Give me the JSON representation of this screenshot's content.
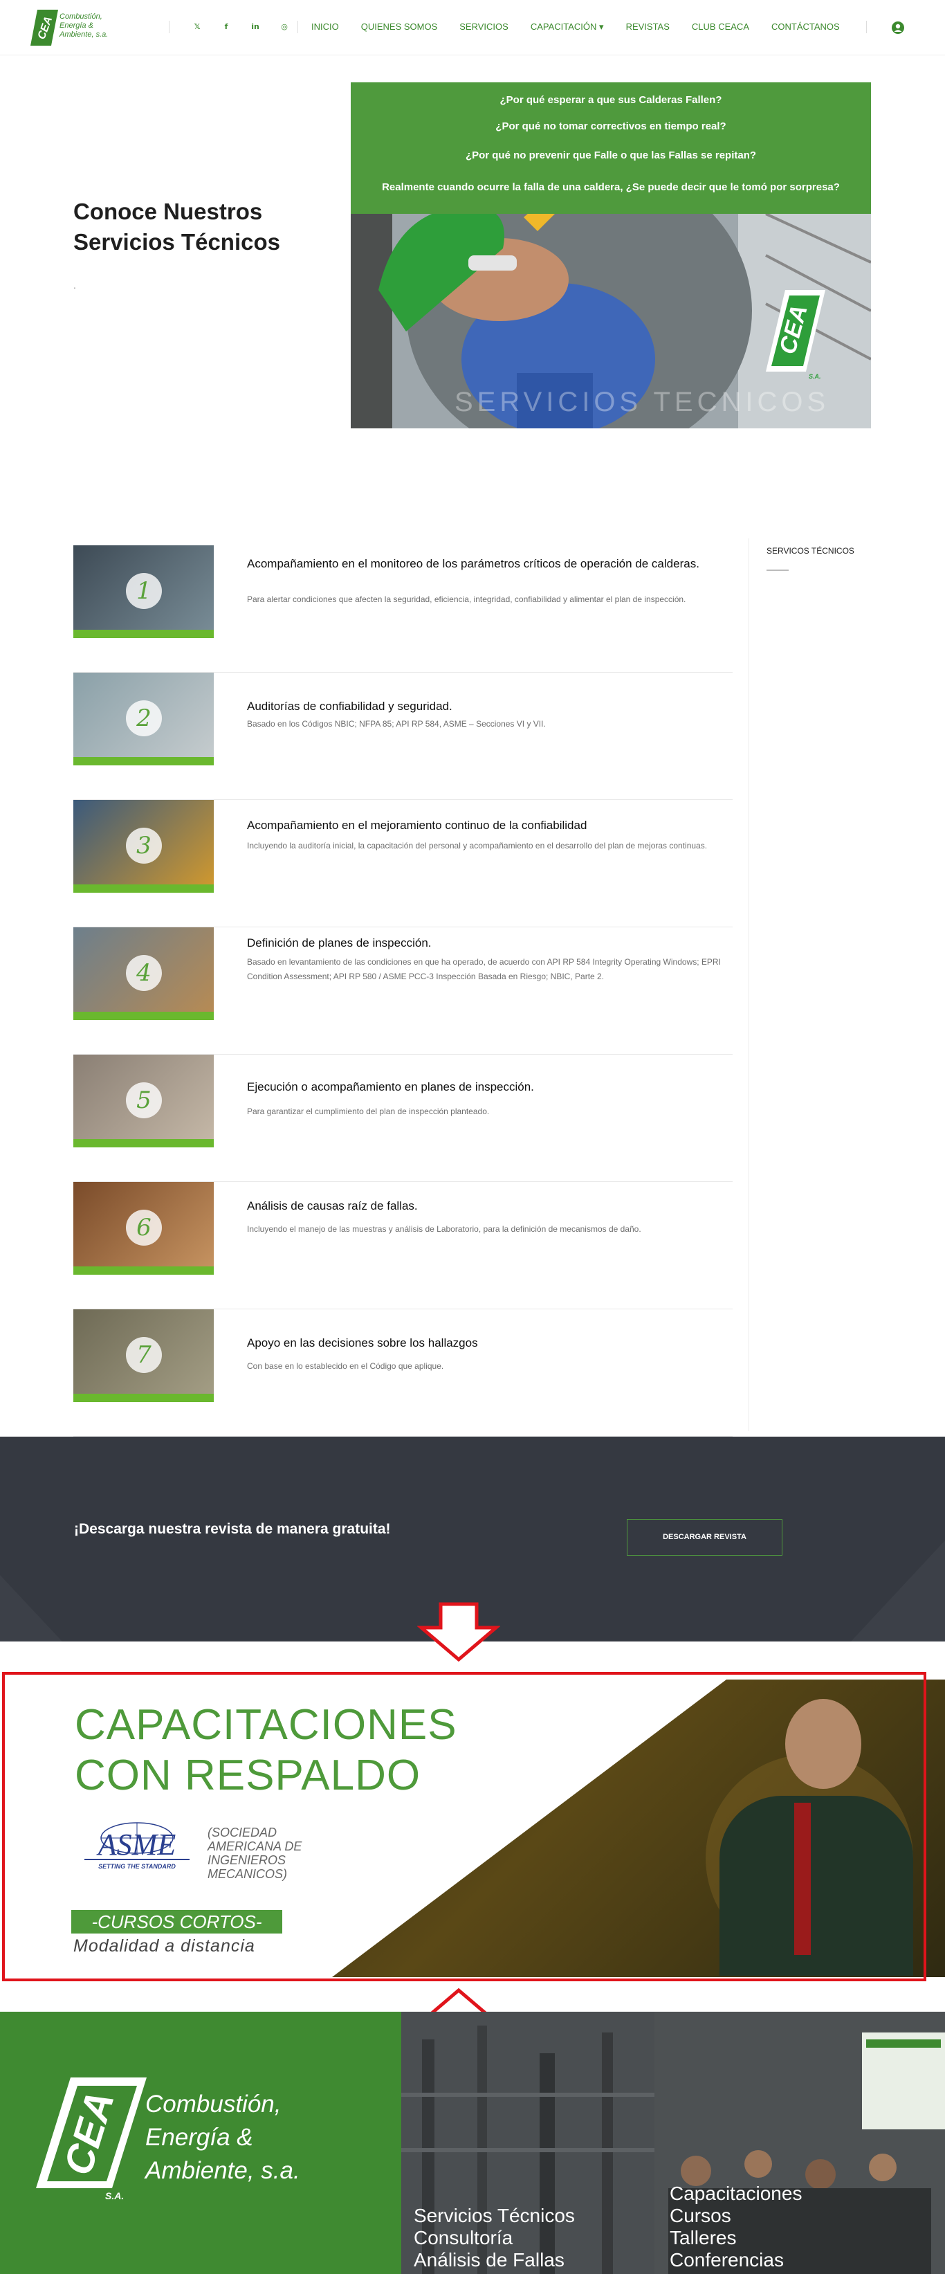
{
  "header": {
    "logo_lines": [
      "Combustión,",
      "Energía &",
      "Ambiente, s.a."
    ],
    "logo_mark": "CEA",
    "social": [
      {
        "icon": "twitter-icon",
        "glyph": "𝕏"
      },
      {
        "icon": "facebook-icon",
        "glyph": "f"
      },
      {
        "icon": "linkedin-icon",
        "glyph": "in"
      },
      {
        "icon": "instagram-icon",
        "glyph": "◎"
      }
    ],
    "nav": [
      "INICIO",
      "QUIENES SOMOS",
      "SERVICIOS",
      "CAPACITACIÓN ▾",
      "REVISTAS",
      "CLUB CEACA",
      "CONTÁCTANOS"
    ],
    "user_icon": "user-circle-icon"
  },
  "hero": {
    "title_line1": "Conoce Nuestros",
    "title_line2": "Servicios Técnicos",
    "dot": ".",
    "questions": [
      "¿Por qué esperar a que sus Calderas Fallen?",
      "¿Por qué no tomar correctivos en tiempo real?",
      "¿Por qué no prevenir que Falle o que las Fallas se repitan?",
      "Realmente cuando ocurre la falla de una caldera, ¿Se puede decir que le tomó por sorpresa?"
    ],
    "watermark": "SERVICIOS TECNICOS",
    "logo_mark": "CEA",
    "logo_sub": "S.A."
  },
  "sidebar": {
    "title": "SERVICOS TÉCNICOS"
  },
  "services": [
    {
      "num": "1",
      "title": "Acompañamiento en el monitoreo de los parámetros críticos de operación de calderas.",
      "desc": "Para alertar condiciones que afecten la seguridad, eficiencia, integridad, confiabilidad y alimentar el plan de inspección."
    },
    {
      "num": "2",
      "title": "Auditorías de confiabilidad y seguridad.",
      "desc": "Basado en los Códigos NBIC; NFPA 85; API RP 584, ASME – Secciones VI y VII."
    },
    {
      "num": "3",
      "title": "Acompañamiento en el mejoramiento continuo de la confiabilidad",
      "desc": "Incluyendo la auditoría inicial, la capacitación del personal y acompañamiento en el desarrollo del plan de mejoras continuas."
    },
    {
      "num": "4",
      "title": "Definición de planes de inspección.",
      "desc": "Basado en levantamiento de las condiciones en que ha operado, de acuerdo con API RP 584 Integrity Operating Windows; EPRI Condition Assessment; API RP 580 / ASME PCC-3 Inspección Basada en Riesgo; NBIC, Parte 2."
    },
    {
      "num": "5",
      "title": "Ejecución o acompañamiento en planes de inspección.",
      "desc": "Para garantizar el cumplimiento del plan de inspección planteado."
    },
    {
      "num": "6",
      "title": "Análisis de causas raíz de fallas.",
      "desc": "Incluyendo el manejo de las muestras y análisis de Laboratorio, para la definición de mecanismos de daño."
    },
    {
      "num": "7",
      "title": "Apoyo en las decisiones sobre los hallazgos",
      "desc": "Con base en lo establecido en el Código que aplique."
    }
  ],
  "download": {
    "text": "¡Descarga nuestra revista de manera gratuita!",
    "button": "DESCARGAR REVISTA"
  },
  "banner": {
    "title_line1": "CAPACITACIONES",
    "title_line2": "CON RESPALDO",
    "asme": "ASME",
    "asme_tagline": "SETTING THE STANDARD",
    "asme_desc": [
      "(SOCIEDAD",
      "AMERICANA DE",
      "INGENIEROS",
      "MECANICOS)"
    ],
    "cursos": "-CURSOS CORTOS-",
    "modalidad": "Modalidad a distancia"
  },
  "footer": {
    "brand": [
      "Combustión,",
      "Energía &",
      "Ambiente, s.a."
    ],
    "logo_mark": "CEA",
    "logo_sub": "S.A.",
    "col1": [
      "Servicios Técnicos",
      "Consultoría",
      "Análisis de Fallas"
    ],
    "col2": [
      "Capacitaciones",
      "Cursos",
      "Talleres",
      "Conferencias"
    ]
  },
  "colors": {
    "brand_green": "#4e9a3a",
    "dark_band": "#353941",
    "highlight_red": "#e0141b"
  }
}
